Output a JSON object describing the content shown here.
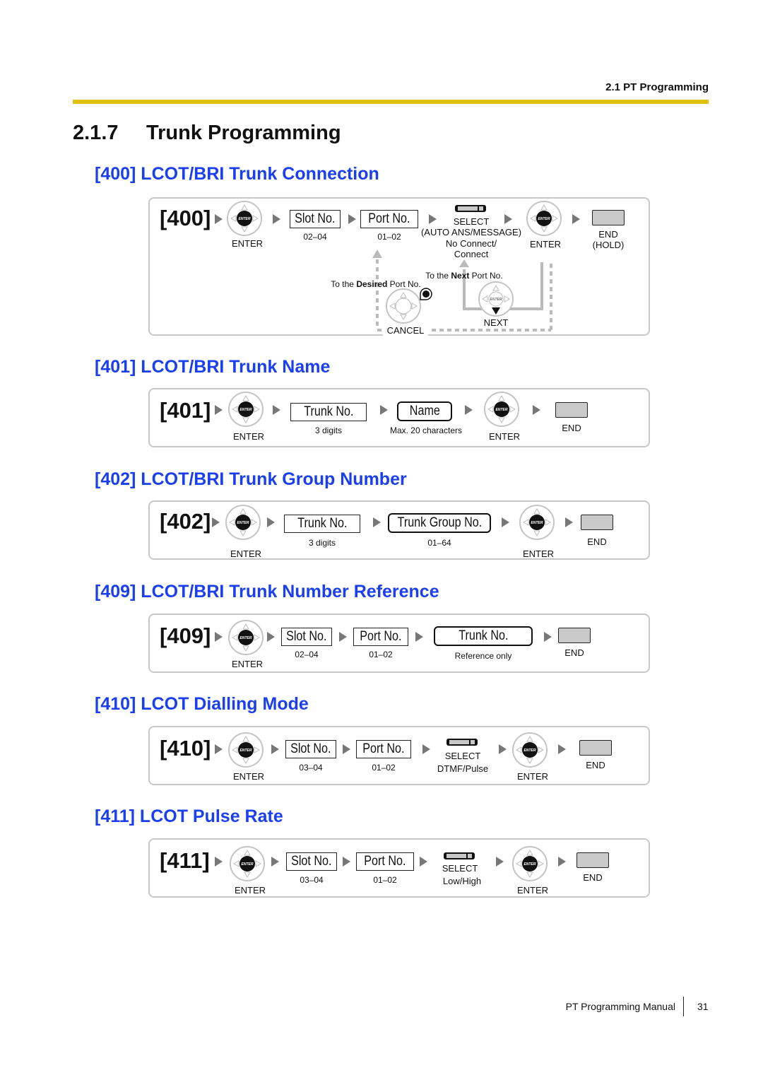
{
  "header": {
    "section": "2.1 PT Programming",
    "accent_color": "#e3bf12"
  },
  "page_title": {
    "number": "2.1.7",
    "text": "Trunk Programming"
  },
  "heading_color": "#1a3ff0",
  "sections": [
    {
      "heading": "[400] LCOT/BRI Trunk Connection",
      "code": "[400]",
      "enter1": "ENTER",
      "slot_label": "Slot No.",
      "slot_range": "02–04",
      "port_label": "Port No.",
      "port_range": "01–02",
      "select_label": "SELECT",
      "select_sub": "(AUTO ANS/MESSAGE)",
      "select_values": [
        "No Connect/",
        "Connect"
      ],
      "enter2": "ENTER",
      "end_label": "END",
      "end_sub": "(HOLD)",
      "desired_prefix": "To the ",
      "desired_bold": "Desired",
      "desired_suffix": " Port No.",
      "next_prefix": "To the ",
      "next_bold": "Next",
      "next_suffix": " Port No.",
      "cancel_label": "CANCEL",
      "next_label": "NEXT"
    },
    {
      "heading": "[401] LCOT/BRI Trunk Name",
      "code": "[401]",
      "enter1": "ENTER",
      "trunk_label": "Trunk No.",
      "trunk_sub": "3 digits",
      "name_label": "Name",
      "name_sub": "Max. 20 characters",
      "enter2": "ENTER",
      "end_label": "END"
    },
    {
      "heading": "[402] LCOT/BRI Trunk Group Number",
      "code": "[402]",
      "enter1": "ENTER",
      "trunk_label": "Trunk No.",
      "trunk_sub": "3 digits",
      "group_label": "Trunk Group No.",
      "group_sub": "01–64",
      "enter2": "ENTER",
      "end_label": "END"
    },
    {
      "heading": "[409] LCOT/BRI Trunk Number Reference",
      "code": "[409]",
      "enter1": "ENTER",
      "slot_label": "Slot No.",
      "slot_range": "02–04",
      "port_label": "Port No.",
      "port_range": "01–02",
      "trunk_label": "Trunk No.",
      "trunk_sub": "Reference only",
      "end_label": "END"
    },
    {
      "heading": "[410] LCOT Dialling Mode",
      "code": "[410]",
      "enter1": "ENTER",
      "slot_label": "Slot No.",
      "slot_range": "03–04",
      "port_label": "Port No.",
      "port_range": "01–02",
      "select_label": "SELECT",
      "select_sub": "DTMF/Pulse",
      "enter2": "ENTER",
      "end_label": "END"
    },
    {
      "heading": "[411] LCOT Pulse Rate",
      "code": "[411]",
      "enter1": "ENTER",
      "slot_label": "Slot No.",
      "slot_range": "03–04",
      "port_label": "Port No.",
      "port_range": "01–02",
      "select_label": "SELECT",
      "select_sub": "Low/High",
      "enter2": "ENTER",
      "end_label": "END"
    }
  ],
  "icons": {
    "enter_key": "navigator-enter-key-icon",
    "select_key": "select-key-icon",
    "end_key": "end-hold-key-icon",
    "arrow": "right-triangle-arrow-icon",
    "cancel_key": "cancel-key-icon"
  },
  "footer": {
    "manual": "PT Programming Manual",
    "page": "31"
  }
}
